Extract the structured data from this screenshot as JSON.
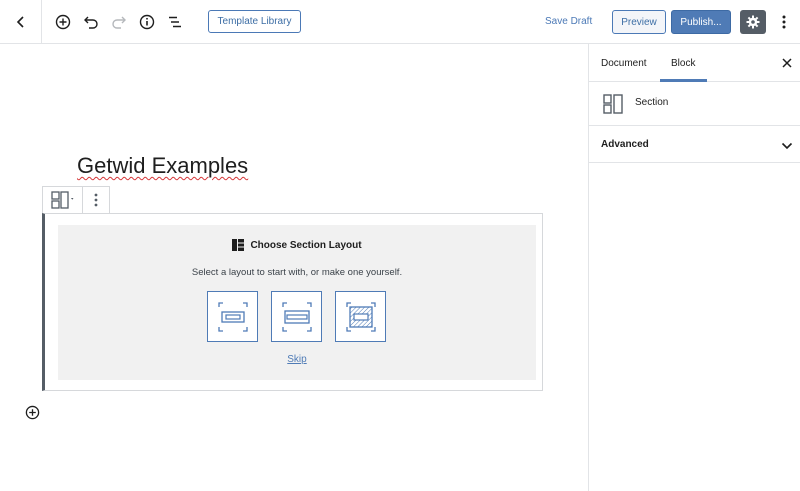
{
  "toolbar": {
    "template_library_label": "Template Library",
    "save_draft_label": "Save Draft",
    "preview_label": "Preview",
    "publish_label": "Publish..."
  },
  "sidebar": {
    "tabs": [
      {
        "label": "Document"
      },
      {
        "label": "Block",
        "active": true
      }
    ],
    "block_name": "Section",
    "advanced_label": "Advanced"
  },
  "editor": {
    "title": "Getwid Examples",
    "section_placeholder": {
      "title": "Choose Section Layout",
      "description": "Select a layout to start with, or make one yourself.",
      "skip_label": "Skip",
      "layout_options": [
        "layout-1",
        "layout-2",
        "layout-3"
      ]
    }
  },
  "colors": {
    "accent": "#4f7bb6",
    "dark_button": "#555d66",
    "placeholder_bg": "#f1f1f1",
    "border": "#e2e4e7"
  }
}
